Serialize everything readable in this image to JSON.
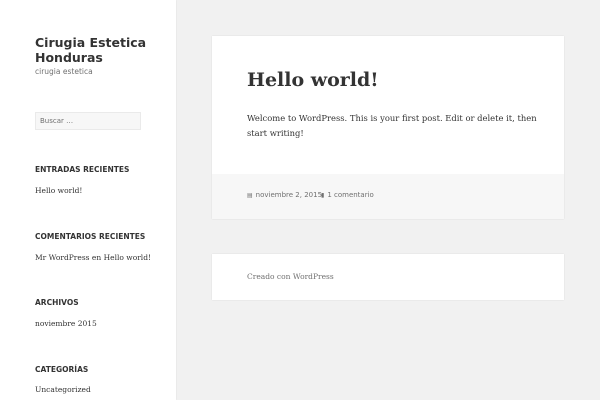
{
  "site": {
    "title": "Cirugia Estetica Honduras",
    "description": "cirugia estetica"
  },
  "search": {
    "placeholder": "Buscar …"
  },
  "widgets": {
    "recent_posts": {
      "title": "ENTRADAS RECIENTES",
      "items": [
        "Hello world!"
      ]
    },
    "recent_comments": {
      "title": "COMENTARIOS RECIENTES",
      "author": "Mr WordPress",
      "connector": "en",
      "post": "Hello world!"
    },
    "archives": {
      "title": "ARCHIVOS",
      "items": [
        "noviembre 2015"
      ]
    },
    "categories": {
      "title": "CATEGORÍAS",
      "items": [
        "Uncategorized"
      ]
    }
  },
  "post": {
    "title": "Hello world!",
    "body": "Welcome to WordPress. This is your first post. Edit or delete it, then start writing!",
    "date": "noviembre 2, 2015",
    "comments": "1 comentario"
  },
  "footer": {
    "credit": "Creado con WordPress"
  },
  "colors": {
    "background": "#f1f1f1",
    "panel": "#ffffff",
    "text": "#333333",
    "muted": "#707070"
  }
}
